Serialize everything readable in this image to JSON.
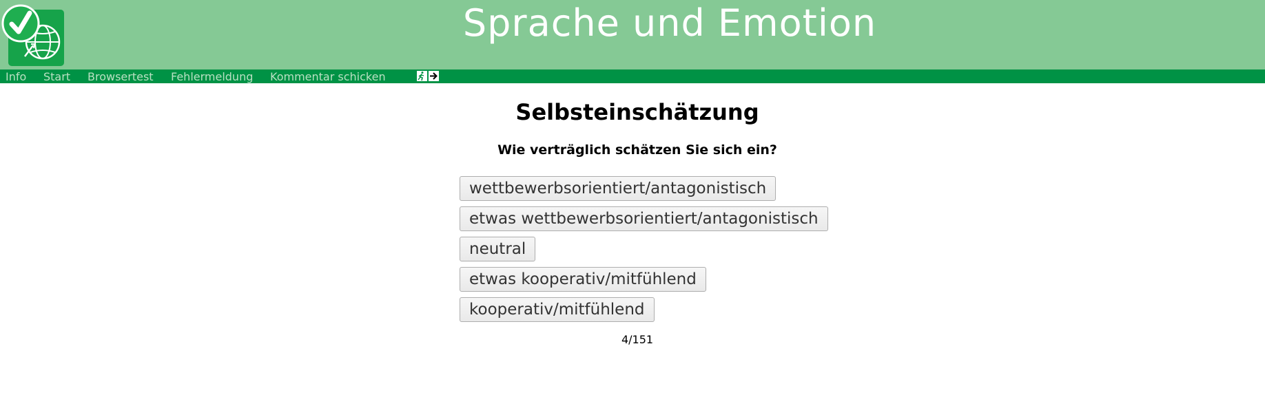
{
  "header": {
    "title": "Sprache und Emotion",
    "logo_icon": "checkmark-globe-logo-icon"
  },
  "nav": {
    "items": [
      {
        "label": "Info"
      },
      {
        "label": "Start"
      },
      {
        "label": "Browsertest"
      },
      {
        "label": "Fehlermeldung"
      },
      {
        "label": "Kommentar schicken"
      }
    ],
    "icons": [
      "emergency-exit-icon",
      "arrow-right-icon"
    ]
  },
  "main": {
    "title": "Selbsteinschätzung",
    "question": "Wie verträglich schätzen Sie sich ein?",
    "options": [
      {
        "label": "wettbewerbsorientiert/antagonistisch"
      },
      {
        "label": "etwas wettbewerbsorientiert/antagonistisch"
      },
      {
        "label": "neutral"
      },
      {
        "label": "etwas kooperativ/mitfühlend"
      },
      {
        "label": "kooperativ/mitfühlend"
      }
    ],
    "progress": "4/151"
  },
  "colors": {
    "header_bg": "#85c995",
    "nav_bg": "#009245",
    "nav_text": "#b9e0c2",
    "logo_green": "#1aa34a"
  }
}
